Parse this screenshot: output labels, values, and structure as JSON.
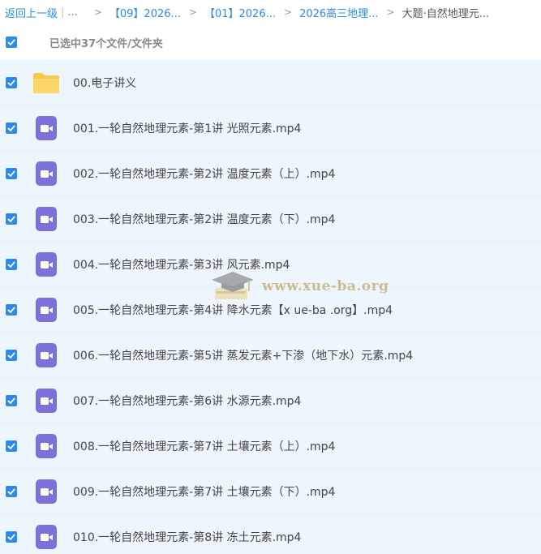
{
  "breadcrumb": {
    "back_label": "返回上一级",
    "ellipsis": "...",
    "crumbs": [
      "【09】2026...",
      "【01】2026...",
      "2026高三地理..."
    ],
    "current": "大题·自然地理元..."
  },
  "selection": {
    "summary": "已选中37个文件/文件夹"
  },
  "files": [
    {
      "name": "00.电子讲义",
      "type": "folder"
    },
    {
      "name": "001.一轮自然地理元素-第1讲 光照元素.mp4",
      "type": "video"
    },
    {
      "name": "002.一轮自然地理元素-第2讲 温度元素（上）.mp4",
      "type": "video"
    },
    {
      "name": "003.一轮自然地理元素-第2讲 温度元素（下）.mp4",
      "type": "video"
    },
    {
      "name": "004.一轮自然地理元素-第3讲 风元素.mp4",
      "type": "video"
    },
    {
      "name": "005.一轮自然地理元素-第4讲 降水元素【x ue-ba .org】.mp4",
      "type": "video"
    },
    {
      "name": "006.一轮自然地理元素-第5讲 蒸发元素+下渗（地下水）元素.mp4",
      "type": "video"
    },
    {
      "name": "007.一轮自然地理元素-第6讲 水源元素.mp4",
      "type": "video"
    },
    {
      "name": "008.一轮自然地理元素-第7讲 土壤元素（上）.mp4",
      "type": "video"
    },
    {
      "name": "009.一轮自然地理元素-第7讲 土壤元素（下）.mp4",
      "type": "video"
    },
    {
      "name": "010.一轮自然地理元素-第8讲 冻土元素.mp4",
      "type": "video"
    }
  ],
  "watermark": {
    "text": "www.xue-ba.org",
    "icon": "graduation-cap-icon"
  },
  "colors": {
    "accent": "#2e8ce9",
    "row_bg": "#eef6fd",
    "folder": "#f8c94a",
    "video": "#7b72d9"
  }
}
